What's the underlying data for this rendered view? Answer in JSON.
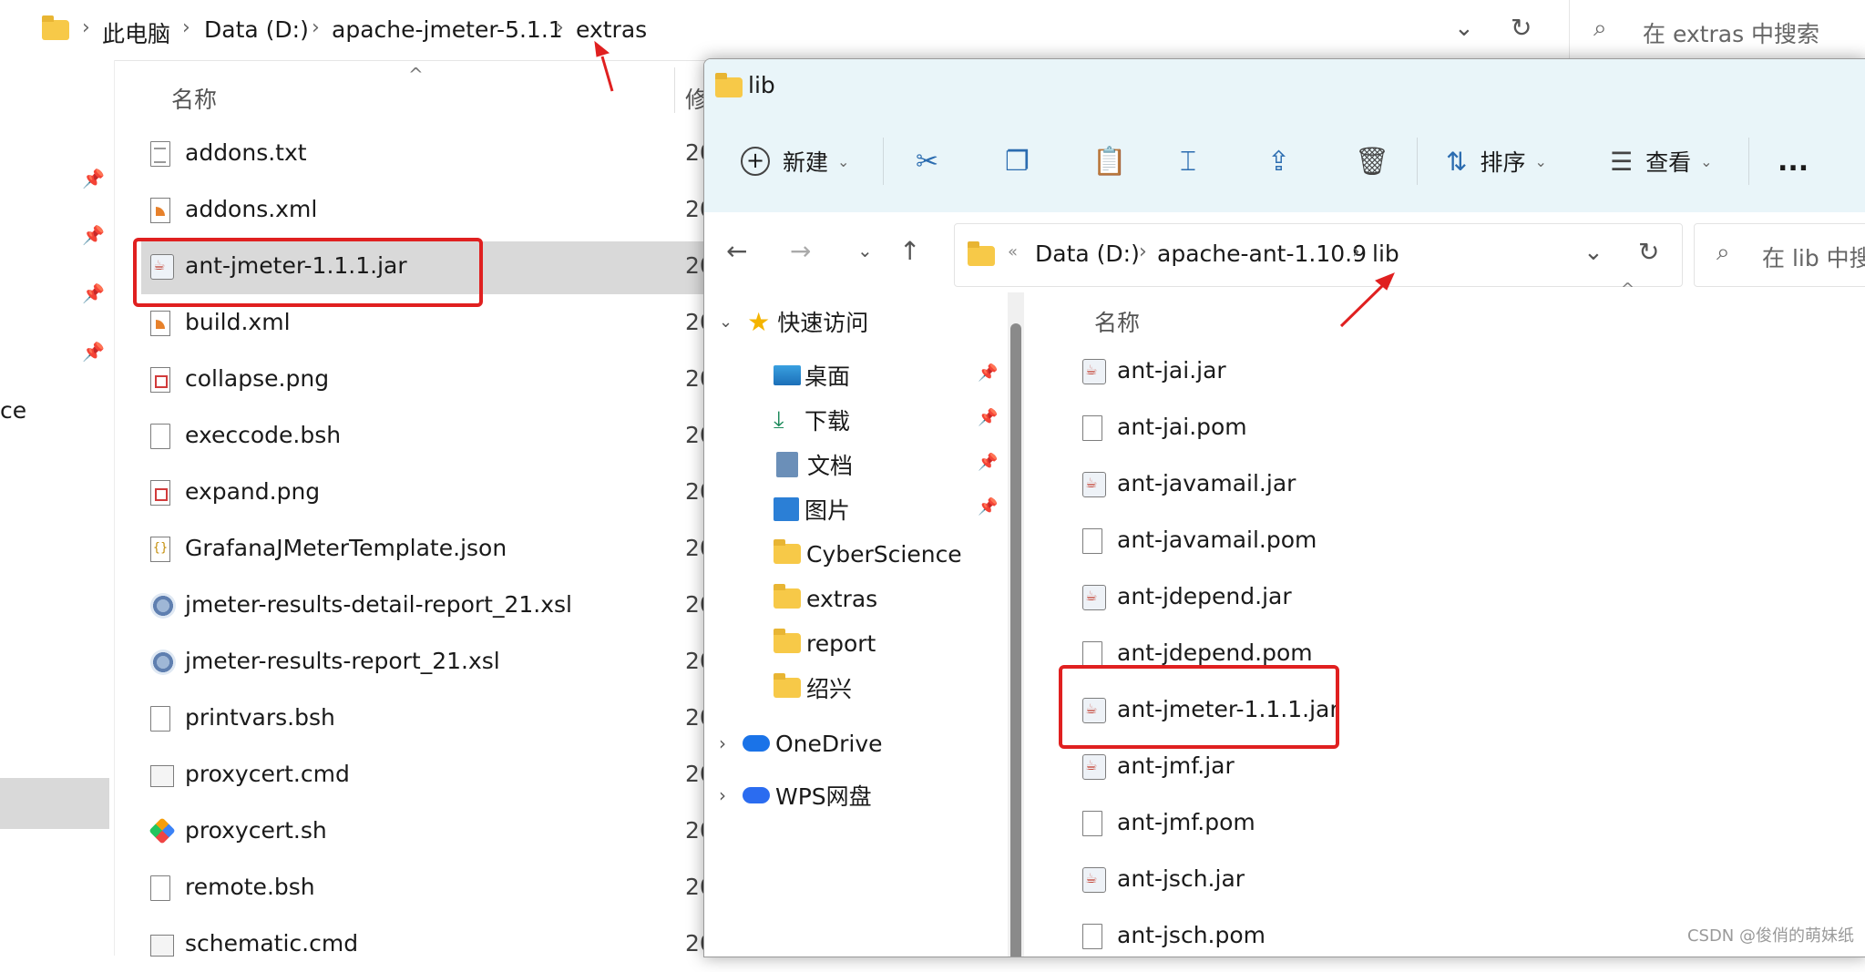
{
  "back_window": {
    "breadcrumb": [
      "此电脑",
      "Data (D:)",
      "apache-jmeter-5.1.1",
      "extras"
    ],
    "search_placeholder": "在 extras 中搜索",
    "column_name": "名称",
    "column_modified": "修",
    "side_text_fragment": "ce",
    "files": [
      {
        "name": "addons.txt",
        "icon": "text-file-icon",
        "date": "20"
      },
      {
        "name": "addons.xml",
        "icon": "xml-file-icon",
        "date": "20"
      },
      {
        "name": "ant-jmeter-1.1.1.jar",
        "icon": "jar-file-icon",
        "date": "20",
        "selected": true
      },
      {
        "name": "build.xml",
        "icon": "xml-file-icon",
        "date": "20"
      },
      {
        "name": "collapse.png",
        "icon": "image-file-icon",
        "date": "20"
      },
      {
        "name": "execcode.bsh",
        "icon": "file-icon",
        "date": "20"
      },
      {
        "name": "expand.png",
        "icon": "image-file-icon",
        "date": "20"
      },
      {
        "name": "GrafanaJMeterTemplate.json",
        "icon": "json-file-icon",
        "date": "20"
      },
      {
        "name": "jmeter-results-detail-report_21.xsl",
        "icon": "xsl-file-icon",
        "date": "20"
      },
      {
        "name": "jmeter-results-report_21.xsl",
        "icon": "xsl-file-icon",
        "date": "20"
      },
      {
        "name": "printvars.bsh",
        "icon": "file-icon",
        "date": "20"
      },
      {
        "name": "proxycert.cmd",
        "icon": "cmd-file-icon",
        "date": "20"
      },
      {
        "name": "proxycert.sh",
        "icon": "sh-file-icon",
        "date": "20"
      },
      {
        "name": "remote.bsh",
        "icon": "file-icon",
        "date": "20"
      },
      {
        "name": "schematic.cmd",
        "icon": "cmd-file-icon",
        "date": "20"
      }
    ]
  },
  "front_window": {
    "title": "lib",
    "toolbar": {
      "new_label": "新建",
      "sort_label": "排序",
      "view_label": "查看",
      "more_label": "..."
    },
    "breadcrumb": [
      "Data (D:)",
      "apache-ant-1.10.9",
      "lib"
    ],
    "search_placeholder": "在 lib 中搜",
    "column_name": "名称",
    "sidebar": {
      "quick_access": "快速访问",
      "items": [
        {
          "label": "桌面",
          "icon": "desktop-icon",
          "pinned": true
        },
        {
          "label": "下载",
          "icon": "download-icon",
          "pinned": true
        },
        {
          "label": "文档",
          "icon": "documents-icon",
          "pinned": true
        },
        {
          "label": "图片",
          "icon": "pictures-icon",
          "pinned": true
        },
        {
          "label": "CyberScience",
          "icon": "folder-icon",
          "pinned": false
        },
        {
          "label": "extras",
          "icon": "folder-icon",
          "pinned": false
        },
        {
          "label": "report",
          "icon": "folder-icon",
          "pinned": false
        },
        {
          "label": "绍兴",
          "icon": "folder-icon",
          "pinned": false
        }
      ],
      "onedrive": "OneDrive",
      "wps": "WPS网盘"
    },
    "files": [
      {
        "name": "ant-jai.jar",
        "icon": "jar-file-icon"
      },
      {
        "name": "ant-jai.pom",
        "icon": "file-icon"
      },
      {
        "name": "ant-javamail.jar",
        "icon": "jar-file-icon"
      },
      {
        "name": "ant-javamail.pom",
        "icon": "file-icon"
      },
      {
        "name": "ant-jdepend.jar",
        "icon": "jar-file-icon"
      },
      {
        "name": "ant-jdepend.pom",
        "icon": "file-icon"
      },
      {
        "name": "ant-jmeter-1.1.1.jar",
        "icon": "jar-file-icon",
        "highlighted": true
      },
      {
        "name": "ant-jmf.jar",
        "icon": "jar-file-icon"
      },
      {
        "name": "ant-jmf.pom",
        "icon": "file-icon"
      },
      {
        "name": "ant-jsch.jar",
        "icon": "jar-file-icon"
      },
      {
        "name": "ant-jsch.pom",
        "icon": "file-icon"
      }
    ]
  },
  "watermark": "CSDN @俊俏的萌妹纸",
  "colors": {
    "annotation_red": "#e02020",
    "titlebar": "#e9f5f9",
    "folder": "#f7c948",
    "selection": "#d9d9d9"
  }
}
